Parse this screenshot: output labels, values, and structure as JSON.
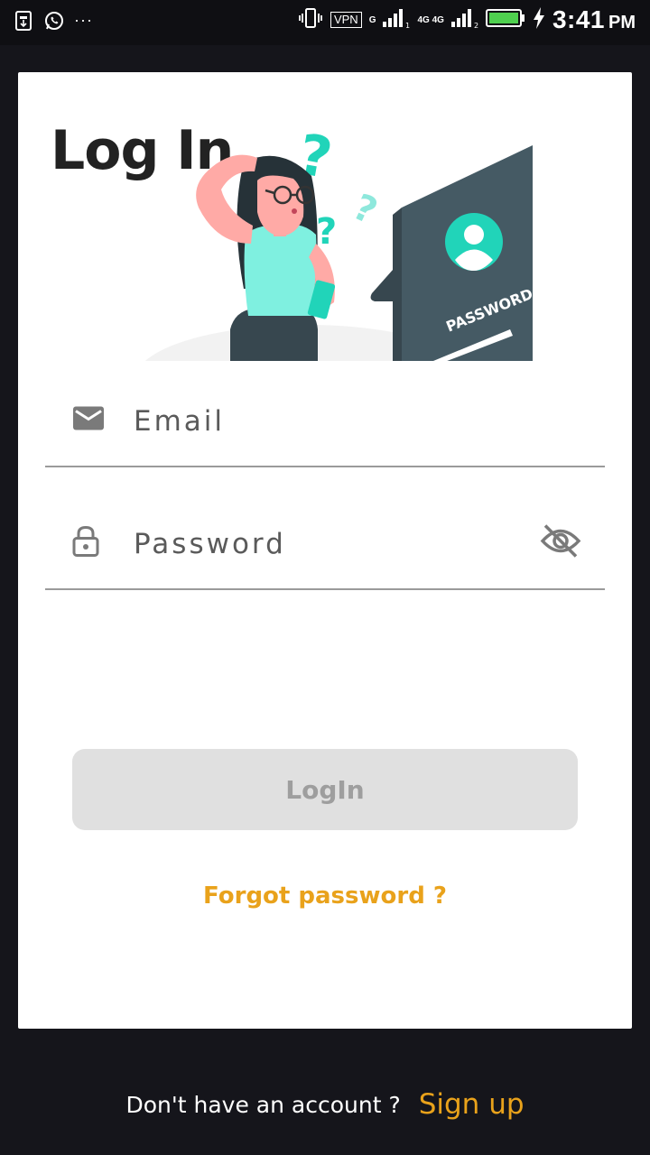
{
  "status_bar": {
    "time": "3:41",
    "ampm": "PM",
    "vpn": "VPN",
    "network_1": "G",
    "network_2": "4G 4G",
    "overflow": "···"
  },
  "login": {
    "title": "Log In",
    "email_placeholder": "Email",
    "password_placeholder": "Password",
    "login_button": "LogIn",
    "forgot_password": "Forgot password ?",
    "illustration_text": "PASSWORD"
  },
  "footer": {
    "prompt": "Don't have an account ?",
    "signup": "Sign up"
  },
  "icons": {
    "email": "mail-icon",
    "password": "lock-icon",
    "visibility": "eye-off-icon"
  },
  "colors": {
    "accent": "#e9a21b",
    "background": "#15151b",
    "button_disabled": "#e0e0e0"
  }
}
